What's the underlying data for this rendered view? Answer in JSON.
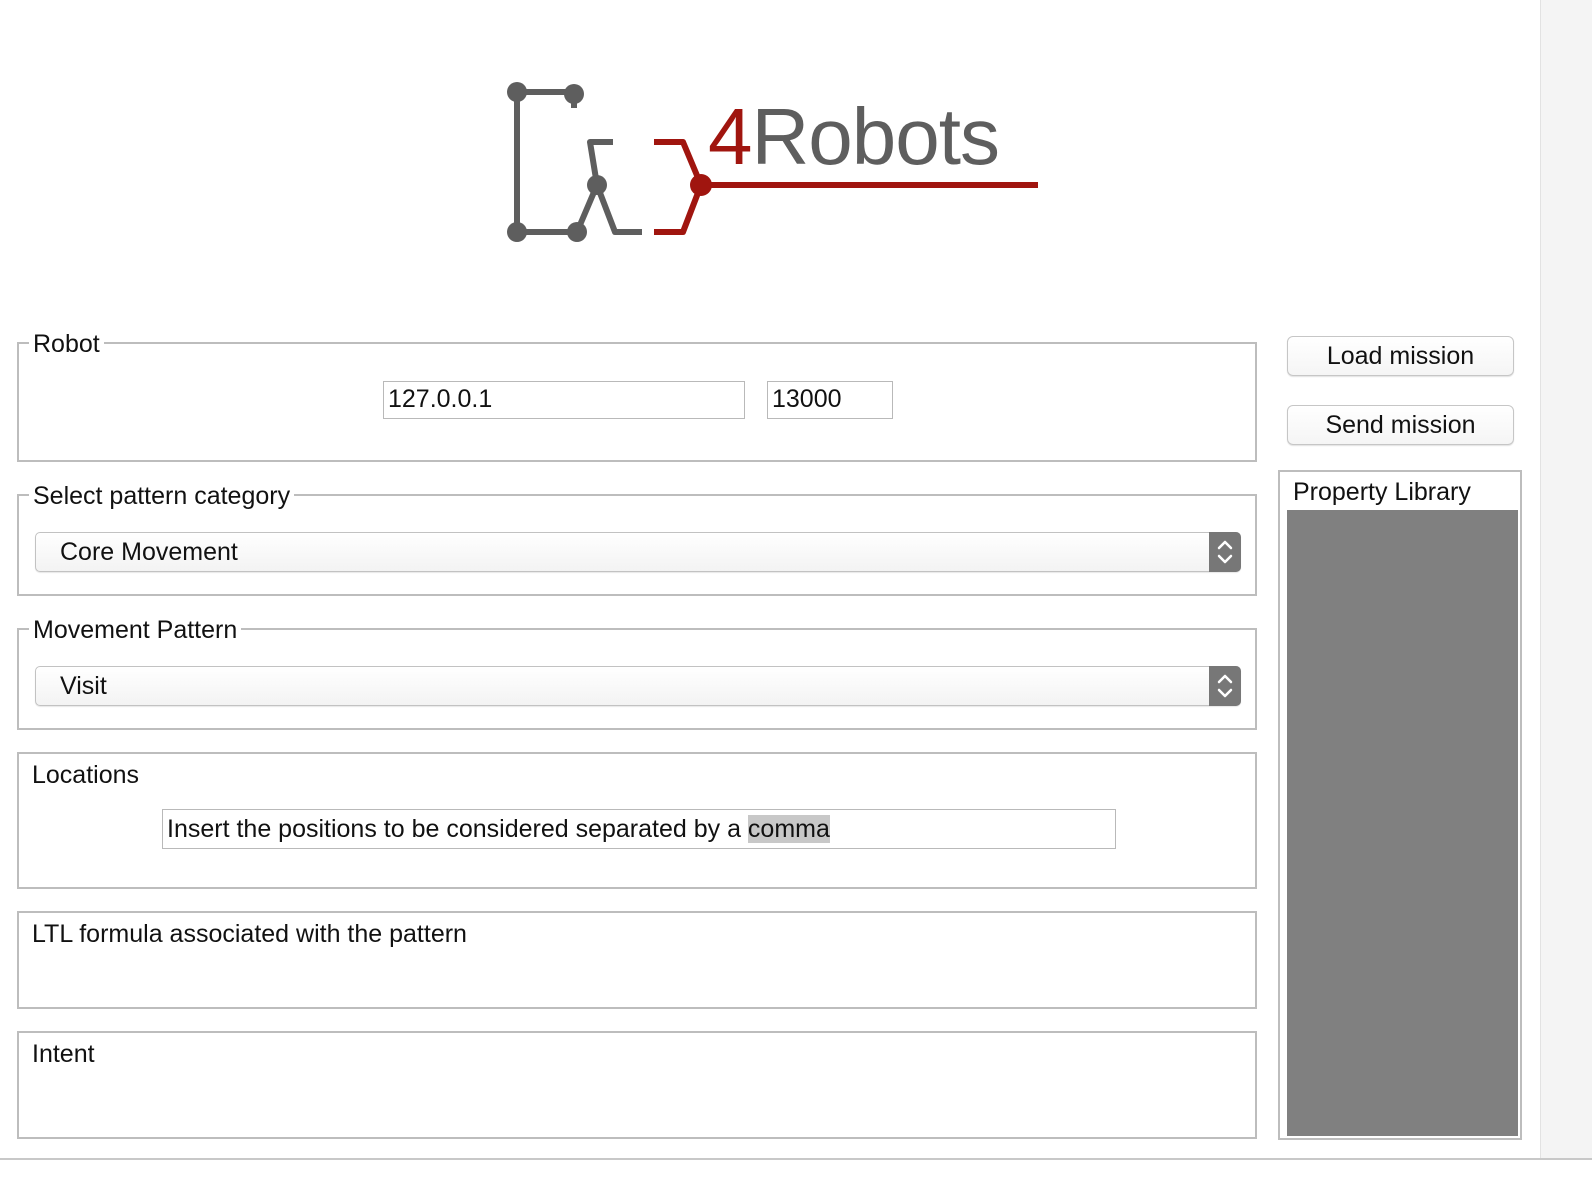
{
  "logo": {
    "digit": "4",
    "word": "Robots",
    "colors": {
      "gray": "#5e5e5e",
      "red": "#a0150f"
    }
  },
  "robot": {
    "legend": "Robot",
    "ip_value": "127.0.0.1",
    "port_value": "13000"
  },
  "pattern_category": {
    "legend": "Select pattern category",
    "selected": "Core Movement"
  },
  "movement_pattern": {
    "legend": "Movement Pattern",
    "selected": "Visit"
  },
  "locations": {
    "title": "Locations",
    "input_text_prefix": "Insert the positions to be considered separated by a ",
    "input_text_selected": "comma"
  },
  "ltl": {
    "title": "LTL formula associated with the pattern"
  },
  "intent": {
    "title": "Intent"
  },
  "buttons": {
    "load_mission": "Load mission",
    "send_mission": "Send mission"
  },
  "property_library": {
    "title": "Property Library",
    "list_color": "#808080"
  }
}
